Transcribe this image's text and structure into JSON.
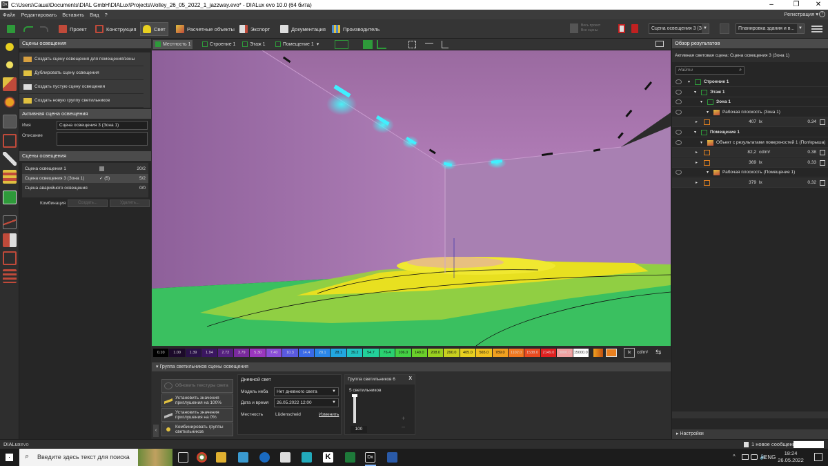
{
  "window": {
    "title": "C:\\Users\\Саша\\Documents\\DIAL GmbH\\DIALux\\Projects\\Volley_26_05_2022_1_jazzway.evo* - DIALux evo 10.0  (64 бита)",
    "app_icon": "Dx"
  },
  "menu": {
    "items": [
      "Файл",
      "Редактировать",
      "Вставить",
      "Вид",
      "?"
    ],
    "registration": "Регистрация ▾"
  },
  "toolbar": {
    "tabs": [
      "Проект",
      "Конструкция",
      "Свет",
      "Расчетные объекты",
      "Экспорт",
      "Документация",
      "Производитель"
    ],
    "active_tab": "Свет",
    "calc_all_line1": "Весь проект",
    "calc_all_line2": "Все сцены",
    "scene_select": "Сцена освещения 3 (Зо...",
    "view_select": "Планировка здания и в..."
  },
  "leftpanel": {
    "header": "Сцены освещения",
    "actions": [
      "Создать сцену освещения для помещения/зоны",
      "Дублировать сцену освещения",
      "Создать пустую сцену освещения",
      "Создать новую группу светильников"
    ],
    "active_scene_header": "Активная сцена освещения",
    "name_label": "Имя",
    "name_value": "Сцена освещения 3 (Зона 1)",
    "desc_label": "Описание",
    "scenes_header": "Сцены освещения",
    "scenes": [
      {
        "name": "Сцена освещения 1",
        "mark": "",
        "count": "20/2"
      },
      {
        "name": "Сцена освещения 3 (Зона 1)",
        "mark": "✓ (5)",
        "count": "5/2"
      },
      {
        "name": "Сцена аварийного освещения",
        "mark": "",
        "count": "0/0"
      }
    ],
    "combo_label": "Комбинация",
    "combo_btn1": "Создать...",
    "combo_btn2": "Удалить..."
  },
  "viewtabs": {
    "items": [
      "Местность 1",
      "Строение 1",
      "Этаж 1",
      "Помещение 1"
    ]
  },
  "colorscale": {
    "values": [
      "0.10",
      "1.00",
      "1.39",
      "1.94",
      "2.72",
      "3.79",
      "5.30",
      "7.40",
      "10.3",
      "14.4",
      "20.1",
      "28.1",
      "39.2",
      "54.7",
      "76.4",
      "106.0",
      "149.0",
      "208.0",
      "290.0",
      "405.0",
      "565.0",
      "789.0",
      "1102.0",
      "1538.0",
      "2149.0",
      "3000.0",
      "15000.0"
    ],
    "colors": [
      "#000000",
      "#1c0a2a",
      "#2a1248",
      "#3a1660",
      "#55207e",
      "#7a2a9e",
      "#9a36be",
      "#8a4ed8",
      "#5a5ae0",
      "#3a6ae8",
      "#2a86e8",
      "#22a6e0",
      "#22c2c0",
      "#22d09a",
      "#2ad070",
      "#44d044",
      "#6ad02a",
      "#9ad020",
      "#c8d020",
      "#e8d020",
      "#f0c020",
      "#f0a020",
      "#f07820",
      "#e84a20",
      "#e02020",
      "#f0a0a0",
      "#ffffff"
    ],
    "unit_lx": "lx",
    "unit_cd": "cd/m²"
  },
  "bottompanel": {
    "header": "Группа светильников сцены освещения",
    "buttons": [
      "Обновить текстуры света",
      "Установить значения приглушения на 100%",
      "Установить значения приглушения на 0%",
      "Комбинировать группы светильников"
    ],
    "daylight_title": "Дневной свет",
    "sky_label": "Модель неба",
    "sky_value": "Нет дневного света",
    "datetime_label": "Дата и время",
    "datetime_value": "26.05.2022 12:00",
    "location_label": "Местность",
    "location_value": "Lüdenscheid",
    "location_change": "Изменить",
    "group_title": "Группа светильников 6",
    "group_close": "X",
    "group_count": "5 светильников",
    "dimmer_value": 100,
    "dimmer_label": "100"
  },
  "rightpanel": {
    "header": "Обзор результатов",
    "active_scene": "Активная световая сцена: Сцена освещения 3 (Зона 1)",
    "search_placeholder": "Найти",
    "tree": [
      {
        "level": 1,
        "label": "Строение 1",
        "bold": true
      },
      {
        "level": 2,
        "label": "Этаж 1",
        "bold": true
      },
      {
        "level": 3,
        "label": "Зона 1",
        "bold": true
      },
      {
        "level": 4,
        "label": "Рабочая плоскость (Зона 1)",
        "bold": false
      },
      {
        "level": 5,
        "value": "407",
        "unit": "lx",
        "ratio": "0.34"
      },
      {
        "level": 2,
        "label": "Помещение 1",
        "bold": true
      },
      {
        "level": 3,
        "label": "Объект с результатами поверхностей 1 (Пол/крыша)",
        "bold": false
      },
      {
        "level": 5,
        "value": "82,2",
        "unit": "cd/m²",
        "ratio": "0.38"
      },
      {
        "level": 5,
        "value": "369",
        "unit": "lx",
        "ratio": "0.33"
      },
      {
        "level": 4,
        "label": "Рабочая плоскость (Помещение 1)",
        "bold": false
      },
      {
        "level": 5,
        "value": "379",
        "unit": "lx",
        "ratio": "0.32"
      }
    ],
    "settings": "Настройки"
  },
  "statusbar": {
    "app_name": "DIALux",
    "app_suffix": "evo",
    "message": "1 новое сообщение"
  },
  "taskbar": {
    "search_placeholder": "Введите здесь текст для поиска",
    "lang": "ENG",
    "time": "18:24",
    "date": "26.05.2022"
  }
}
